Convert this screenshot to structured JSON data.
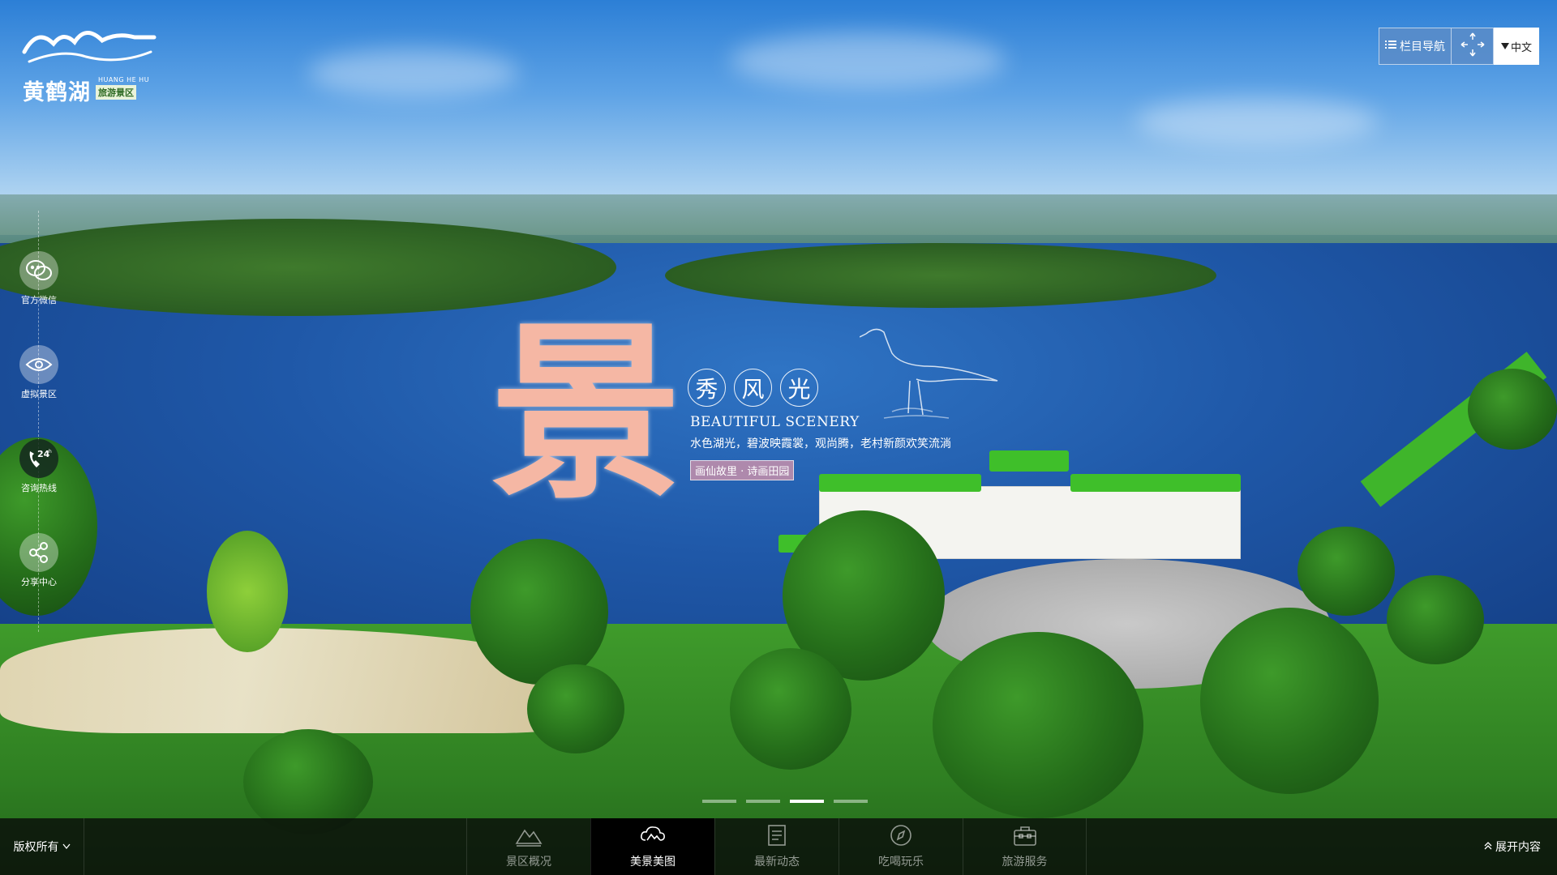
{
  "logo": {
    "name_cn": "黄鹤湖",
    "name_en": "HUANG HE HU",
    "subtitle": "旅游景区"
  },
  "topnav": {
    "menu_label": "栏目导航",
    "menu_icon": "list-icon",
    "fullscreen_icon": "arrows-expand-icon",
    "language_label": "中文",
    "language_icon": "caret-down-icon"
  },
  "sidebar": {
    "items": [
      {
        "label": "官方微信",
        "icon": "wechat-icon"
      },
      {
        "label": "虚拟景区",
        "icon": "eye-icon"
      },
      {
        "label": "咨询热线",
        "icon": "phone-24h-icon"
      },
      {
        "label": "分享中心",
        "icon": "share-icon"
      }
    ]
  },
  "hero": {
    "big_char": "景",
    "ring_chars": [
      "秀",
      "风",
      "光"
    ],
    "en_title": "BEAUTIFUL SCENERY",
    "slogan": "水色湖光，碧波映霞裳，观尚腾，老村新颜欢笑流淌",
    "tag": "画仙故里 · 诗画田园"
  },
  "carousel": {
    "slide_count": 4,
    "active_index": 2
  },
  "bottombar": {
    "copyright_label": "版权所有",
    "tabs": [
      {
        "label": "景区概况",
        "icon": "mountain-icon"
      },
      {
        "label": "美景美图",
        "icon": "cloud-landscape-icon"
      },
      {
        "label": "最新动态",
        "icon": "document-icon"
      },
      {
        "label": "吃喝玩乐",
        "icon": "compass-icon"
      },
      {
        "label": "旅游服务",
        "icon": "suitcase-icon"
      }
    ],
    "active_tab": 1,
    "expand_label": "展开内容"
  },
  "colors": {
    "accent_pink": "#f5b7a4",
    "nav_blue": "#5a8cc8",
    "bar_dark": "#0a0c0a"
  }
}
